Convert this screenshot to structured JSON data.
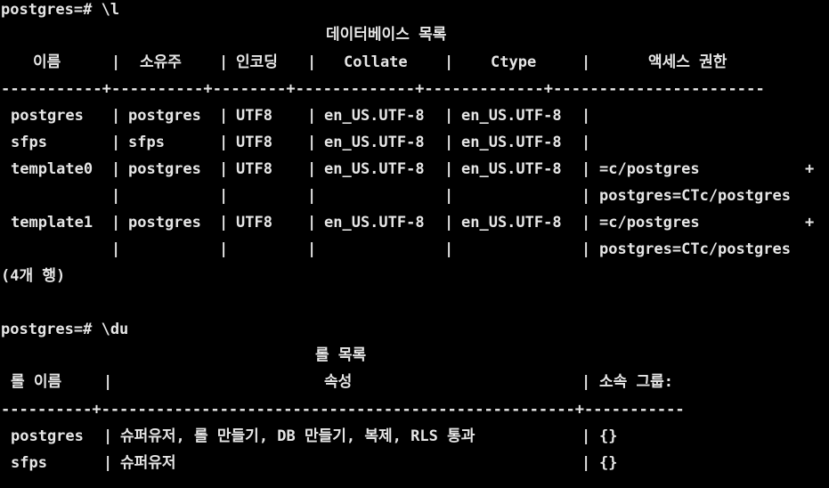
{
  "terminal": {
    "prompt1": "postgres=# \\l",
    "db_title": "데이터베이스 목록",
    "db_headers": {
      "name": "이름",
      "owner": "소유주",
      "encoding": "인코딩",
      "collate": "Collate",
      "ctype": "Ctype",
      "access": "액세스 권한"
    },
    "db_rule": "-----------+----------+--------+-------------+-------------+-----------------------",
    "db_rows": [
      {
        "name": "postgres",
        "owner": "postgres",
        "encoding": "UTF8",
        "collate": "en_US.UTF-8",
        "ctype": "en_US.UTF-8",
        "access": "",
        "access_cont": ""
      },
      {
        "name": "sfps",
        "owner": "sfps",
        "encoding": "UTF8",
        "collate": "en_US.UTF-8",
        "ctype": "en_US.UTF-8",
        "access": "",
        "access_cont": ""
      },
      {
        "name": "template0",
        "owner": "postgres",
        "encoding": "UTF8",
        "collate": "en_US.UTF-8",
        "ctype": "en_US.UTF-8",
        "access": "=c/postgres",
        "plus": "+",
        "access_cont": "postgres=CTc/postgres"
      },
      {
        "name": "template1",
        "owner": "postgres",
        "encoding": "UTF8",
        "collate": "en_US.UTF-8",
        "ctype": "en_US.UTF-8",
        "access": "=c/postgres",
        "plus": "+",
        "access_cont": "postgres=CTc/postgres"
      }
    ],
    "db_count": "(4개 행)",
    "prompt2": "postgres=# \\du",
    "role_title": "롤 목록",
    "role_headers": {
      "name": "롤 이름",
      "attributes": "속성",
      "member_of": "소속 그룹:"
    },
    "role_rule": "----------+----------------------------------------------------+-----------",
    "role_rows": [
      {
        "name": "postgres",
        "attributes": "슈퍼유저, 롤 만들기, DB 만들기, 복제, RLS 통과",
        "member_of": "{}"
      },
      {
        "name": "sfps",
        "attributes": "슈퍼유저",
        "member_of": "{}"
      }
    ],
    "pipe": "|"
  }
}
